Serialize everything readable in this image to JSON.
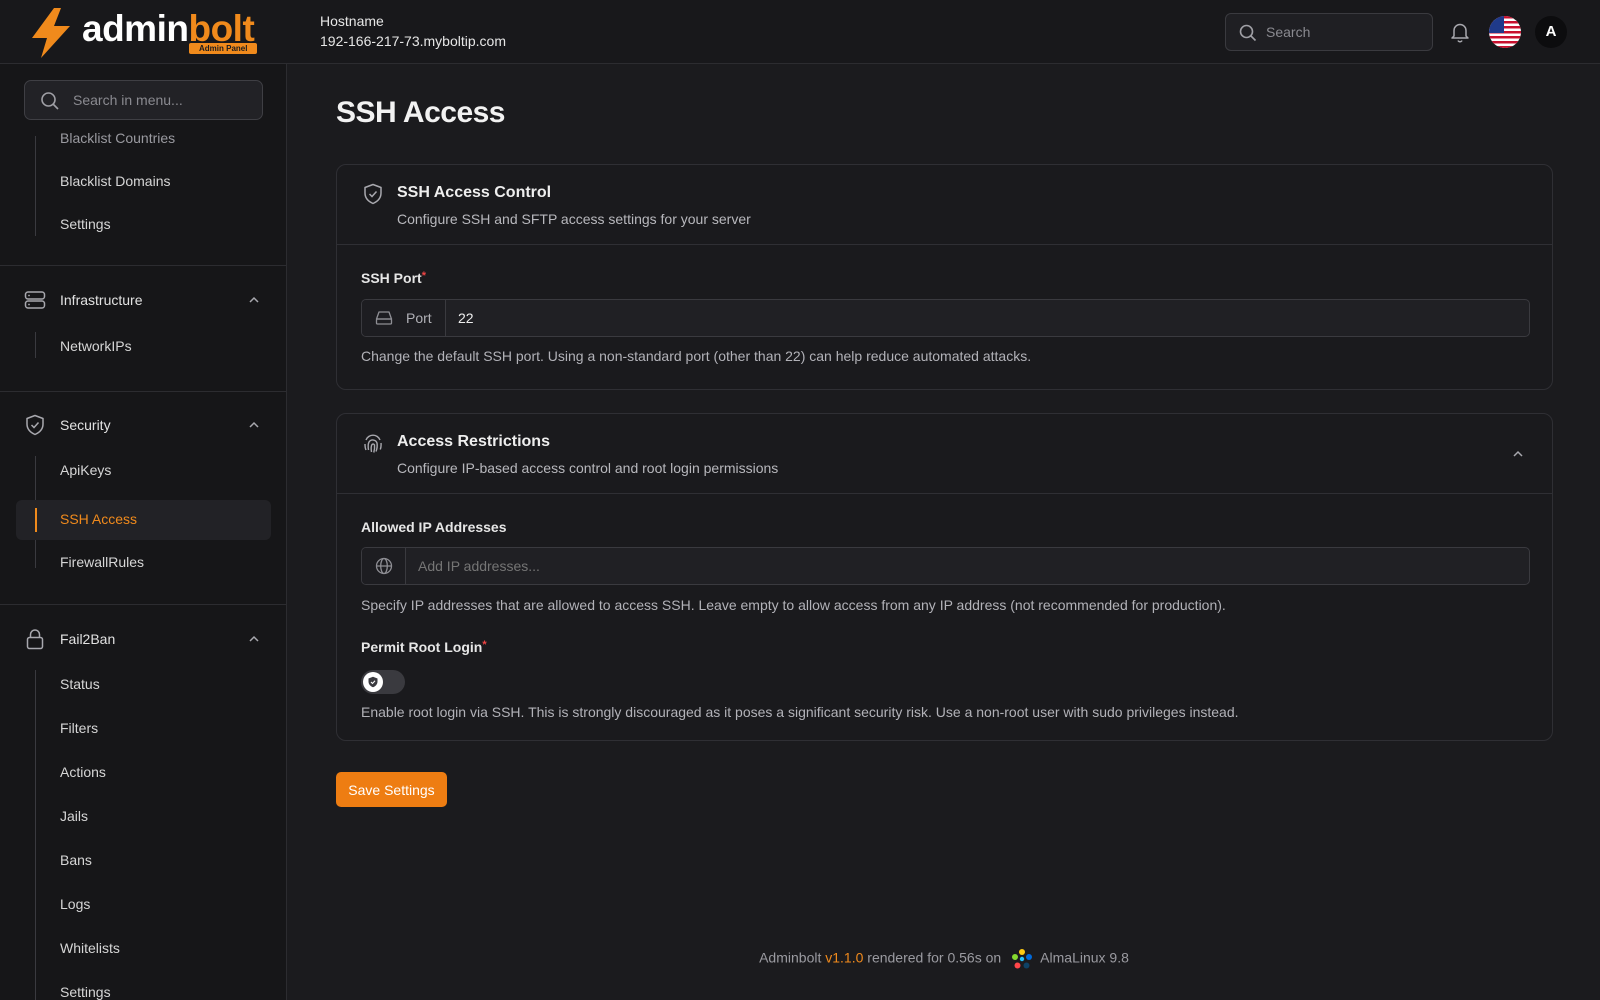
{
  "brand": {
    "name_white": "admin",
    "name_orange": "bolt",
    "badge": "Admin Panel"
  },
  "header": {
    "hostname_label": "Hostname",
    "hostname_value": "192-166-217-73.myboltip.com",
    "search_placeholder": "Search",
    "avatar_initial": "A"
  },
  "sidebar": {
    "search_placeholder": "Search in menu...",
    "partial_item": "Blacklist Countries",
    "top_items": [
      "Blacklist Domains",
      "Settings"
    ],
    "groups": [
      {
        "label": "Infrastructure",
        "icon": "server-icon",
        "items": [
          "NetworkIPs"
        ]
      },
      {
        "label": "Security",
        "icon": "shield-check-icon",
        "items": [
          "ApiKeys",
          "SSH Access",
          "FirewallRules"
        ],
        "active": "SSH Access"
      },
      {
        "label": "Fail2Ban",
        "icon": "lock-icon",
        "items": [
          "Status",
          "Filters",
          "Actions",
          "Jails",
          "Bans",
          "Logs",
          "Whitelists",
          "Settings"
        ]
      }
    ]
  },
  "page": {
    "title": "SSH Access",
    "ssh_card": {
      "title": "SSH Access Control",
      "subtitle": "Configure SSH and SFTP access settings for your server",
      "port_label": "SSH Port",
      "port_addon": "Port",
      "port_value": "22",
      "port_help": "Change the default SSH port. Using a non-standard port (other than 22) can help reduce automated attacks."
    },
    "restrictions_card": {
      "title": "Access Restrictions",
      "subtitle": "Configure IP-based access control and root login permissions",
      "ip_label": "Allowed IP Addresses",
      "ip_placeholder": "Add IP addresses...",
      "ip_help": "Specify IP addresses that are allowed to access SSH. Leave empty to allow access from any IP address (not recommended for production).",
      "root_label": "Permit Root Login",
      "root_enabled": false,
      "root_help": "Enable root login via SSH. This is strongly discouraged as it poses a significant security risk. Use a non-root user with sudo privileges instead."
    },
    "save_label": "Save Settings"
  },
  "footer": {
    "app": "Adminbolt",
    "version": "v1.1.0",
    "rendered": "rendered for 0.56s on",
    "os": "AlmaLinux 9.8"
  },
  "colors": {
    "accent": "#f08a1c",
    "button": "#ee7d12",
    "background": "#1b1b1e",
    "required": "#ef4444"
  }
}
